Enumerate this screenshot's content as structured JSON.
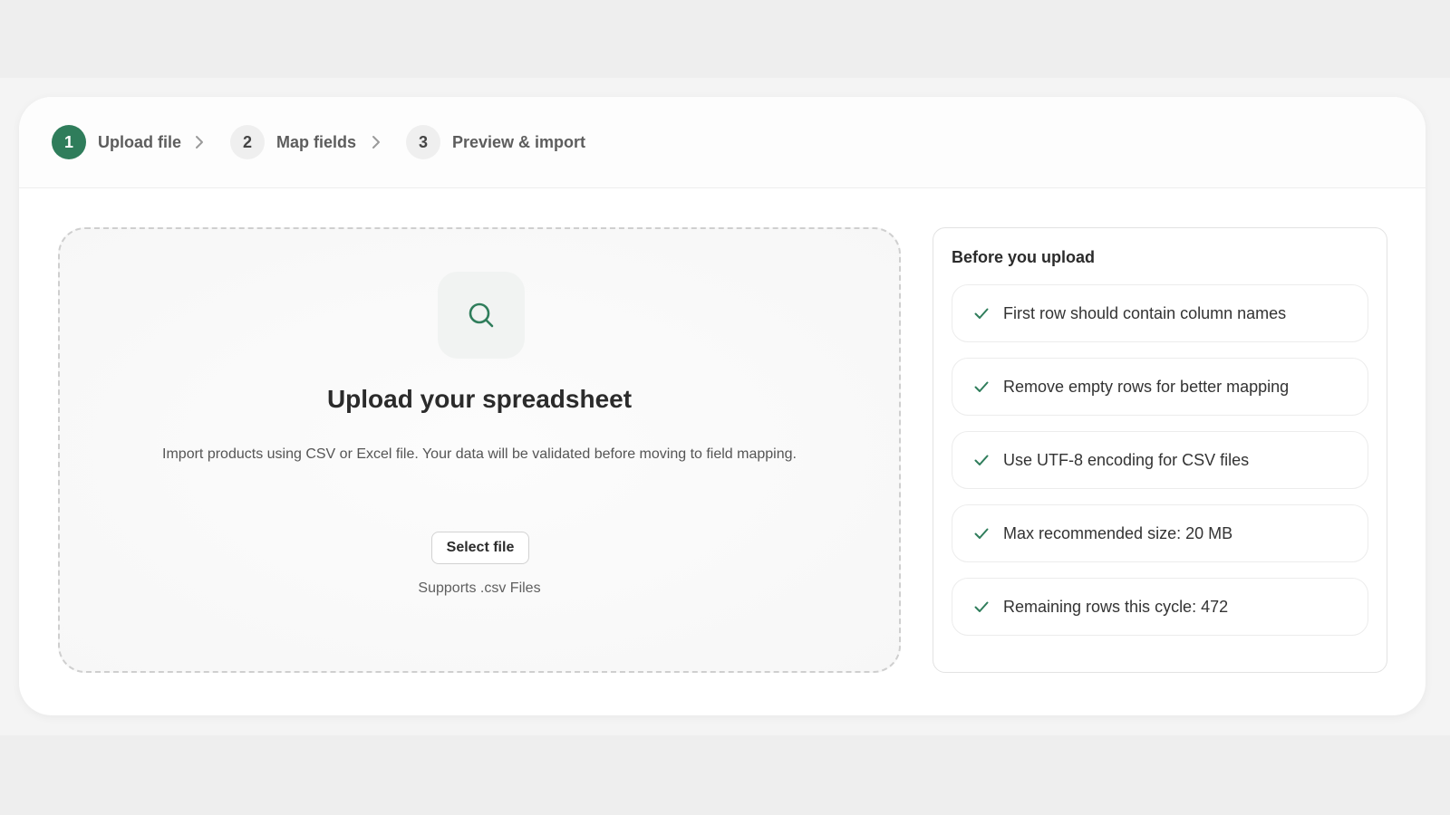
{
  "stepper": {
    "steps": [
      {
        "number": "1",
        "label": "Upload file",
        "active": true
      },
      {
        "number": "2",
        "label": "Map fields",
        "active": false
      },
      {
        "number": "3",
        "label": "Preview & import",
        "active": false
      }
    ],
    "separator_icon": "chevron-right-icon"
  },
  "dropzone": {
    "icon": "search-icon",
    "title": "Upload your spreadsheet",
    "description": "Import products using CSV or Excel file. Your data will be validated before moving to field mapping.",
    "button_label": "Select file",
    "hint": "Supports .csv Files"
  },
  "tips": {
    "title": "Before you upload",
    "icon": "check-icon",
    "items": [
      {
        "text": "First row should contain column names"
      },
      {
        "text": "Remove empty rows for better mapping"
      },
      {
        "text": "Use UTF-8 encoding for CSV files"
      },
      {
        "text": "Max recommended size: 20 MB"
      },
      {
        "text": "Remaining rows this cycle: 472"
      }
    ]
  },
  "colors": {
    "accent": "#2f7d5b",
    "background": "#eeeeee",
    "card": "#ffffff"
  }
}
